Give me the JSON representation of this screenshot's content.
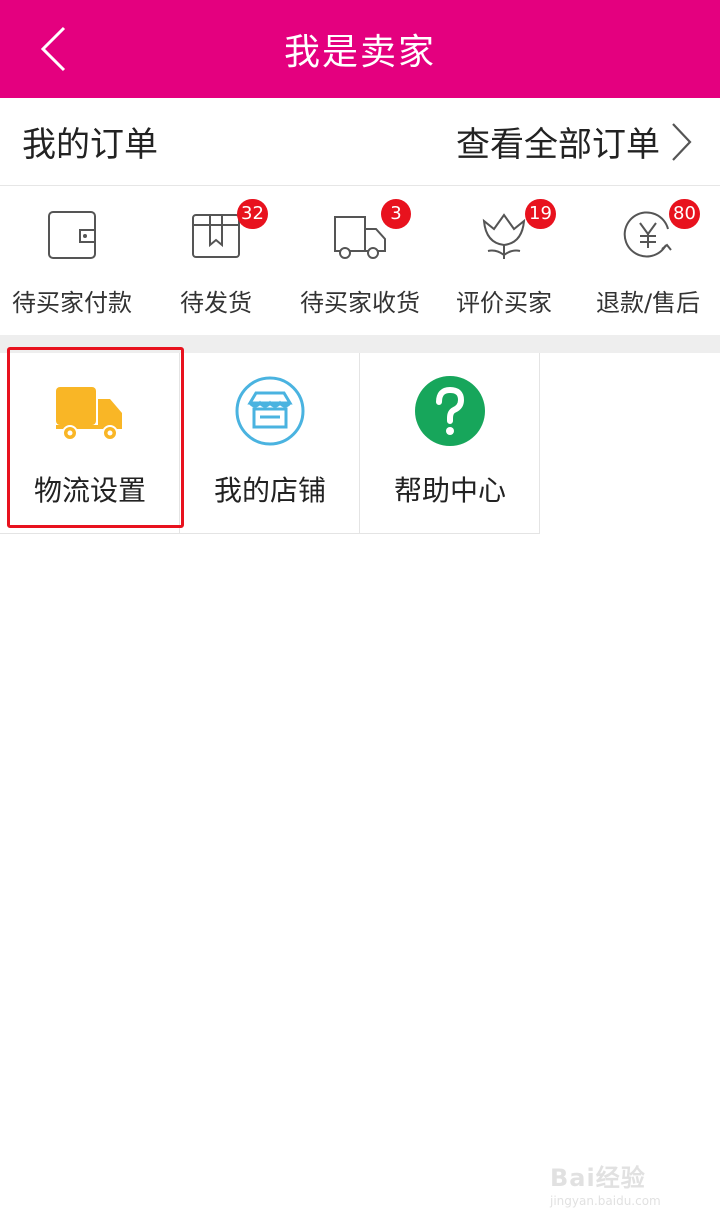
{
  "header": {
    "title": "我是卖家",
    "back_icon": "chevron-left-icon",
    "bg_color": "#e4007f"
  },
  "orders": {
    "title": "我的订单",
    "view_all_label": "查看全部订单"
  },
  "status_items": [
    {
      "label": "待买家付款",
      "icon": "wallet-icon",
      "badge": ""
    },
    {
      "label": "待发货",
      "icon": "package-icon",
      "badge": "32"
    },
    {
      "label": "待买家收货",
      "icon": "truck-icon",
      "badge": "3"
    },
    {
      "label": "评价买家",
      "icon": "tulip-icon",
      "badge": "19"
    },
    {
      "label": "退款/售后",
      "icon": "yen-refund-icon",
      "badge": "80"
    }
  ],
  "tools": [
    {
      "label": "物流设置",
      "icon": "delivery-truck-icon",
      "color": "#f9b626"
    },
    {
      "label": "我的店铺",
      "icon": "storefront-icon",
      "color": "#4ab3e0"
    },
    {
      "label": "帮助中心",
      "icon": "question-icon",
      "color": "#17a65b"
    }
  ],
  "watermark": {
    "main": "Bai经验",
    "sub": "jingyan.baidu.com"
  }
}
